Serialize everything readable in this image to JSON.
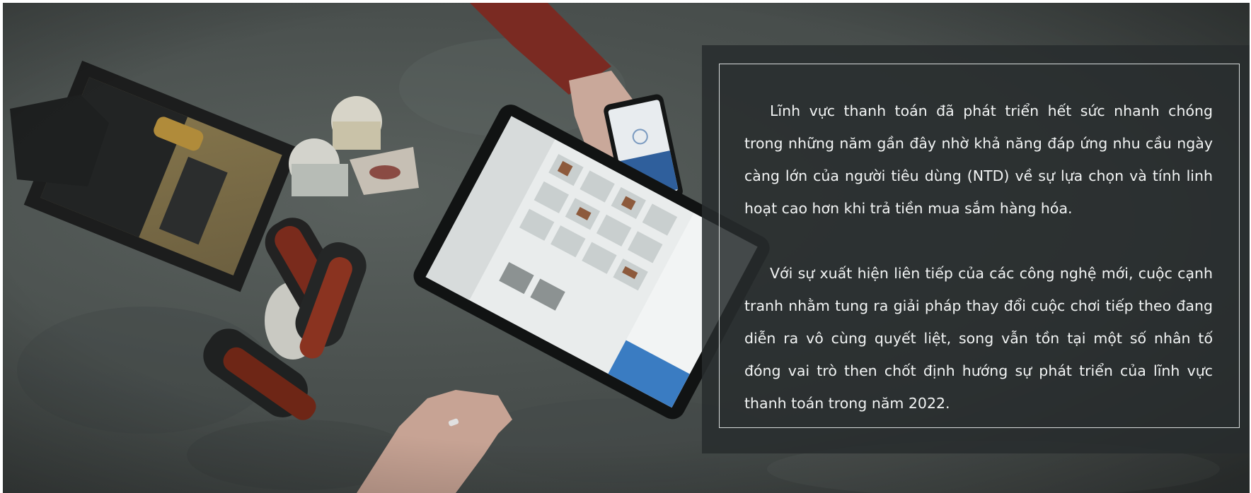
{
  "banner": {
    "paragraphs": [
      "Lĩnh vực thanh toán đã phát triển hết sức nhanh chóng trong những năm gần đây nhờ khả năng đáp ứng nhu cầu ngày càng lớn của người tiêu dùng (NTD) về sự lựa chọn và tính linh hoạt cao hơn khi trả tiền mua sắm hàng hóa.",
      "Với sự xuất hiện liên tiếp của các công nghệ mới, cuộc cạnh tranh nhằm tung ra giải pháp thay đổi cuộc chơi tiếp theo đang diễn ra vô cùng quyết liệt, song vẫn tồn tại một số nhân tố đóng vai trò then chốt định hướng sự phát triển của lĩnh vực thanh toán trong năm 2022."
    ]
  },
  "colors": {
    "background": "#4f5553",
    "overlay": "#2b2f30",
    "frame": "#d8dcdc",
    "text": "#f2f4f4"
  }
}
